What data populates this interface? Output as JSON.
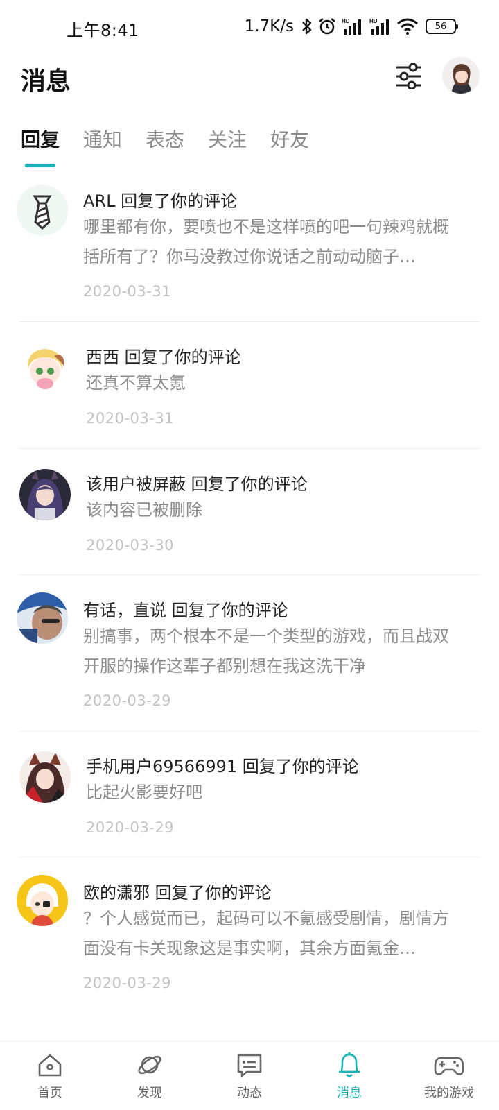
{
  "status_bar": {
    "time": "上午8:41",
    "speed": "1.7K/s",
    "battery": "56",
    "icons": [
      "bluetooth-icon",
      "alarm-icon",
      "signal-icon",
      "signal-icon",
      "wifi-icon",
      "battery-icon"
    ]
  },
  "header": {
    "title": "消息",
    "filter_icon": "sliders-icon",
    "avatar": "avatar"
  },
  "tabs": [
    {
      "label": "回复",
      "active": true
    },
    {
      "label": "通知",
      "active": false
    },
    {
      "label": "表态",
      "active": false
    },
    {
      "label": "关注",
      "active": false
    },
    {
      "label": "好友",
      "active": false
    }
  ],
  "messages": [
    {
      "title": "ARL 回复了你的评论",
      "body": "哪里都有你，要喷也不是这样喷的吧一句辣鸡就概括所有了？你马没教过你说话之前动动脑子…",
      "date": "2020-03-31"
    },
    {
      "title": "西西 回复了你的评论",
      "body": "还真不算太氪",
      "date": "2020-03-31"
    },
    {
      "title": "该用户被屏蔽 回复了你的评论",
      "body": "该内容已被删除",
      "date": "2020-03-30"
    },
    {
      "title": "有话，直说 回复了你的评论",
      "body": "别搞事，两个根本不是一个类型的游戏，而且战双开服的操作这辈子都别想在我这洗干净",
      "date": "2020-03-29"
    },
    {
      "title": "手机用户69566991 回复了你的评论",
      "body": "比起火影要好吧",
      "date": "2020-03-29"
    },
    {
      "title": "欧的潇邪 回复了你的评论",
      "body": "？个人感觉而已，起码可以不氪感受剧情，剧情方面没有卡关现象这是事实啊，其余方面氪金…",
      "date": "2020-03-29"
    }
  ],
  "bottom_nav": [
    {
      "label": "首页",
      "icon": "home-icon",
      "active": false
    },
    {
      "label": "发现",
      "icon": "planet-icon",
      "active": false
    },
    {
      "label": "动态",
      "icon": "chat-icon",
      "active": false
    },
    {
      "label": "消息",
      "icon": "bell-icon",
      "active": true
    },
    {
      "label": "我的游戏",
      "icon": "gamepad-icon",
      "active": false
    }
  ],
  "colors": {
    "accent": "#1bb3b3",
    "muted": "#8c8c8c",
    "date": "#c2c2c2"
  }
}
